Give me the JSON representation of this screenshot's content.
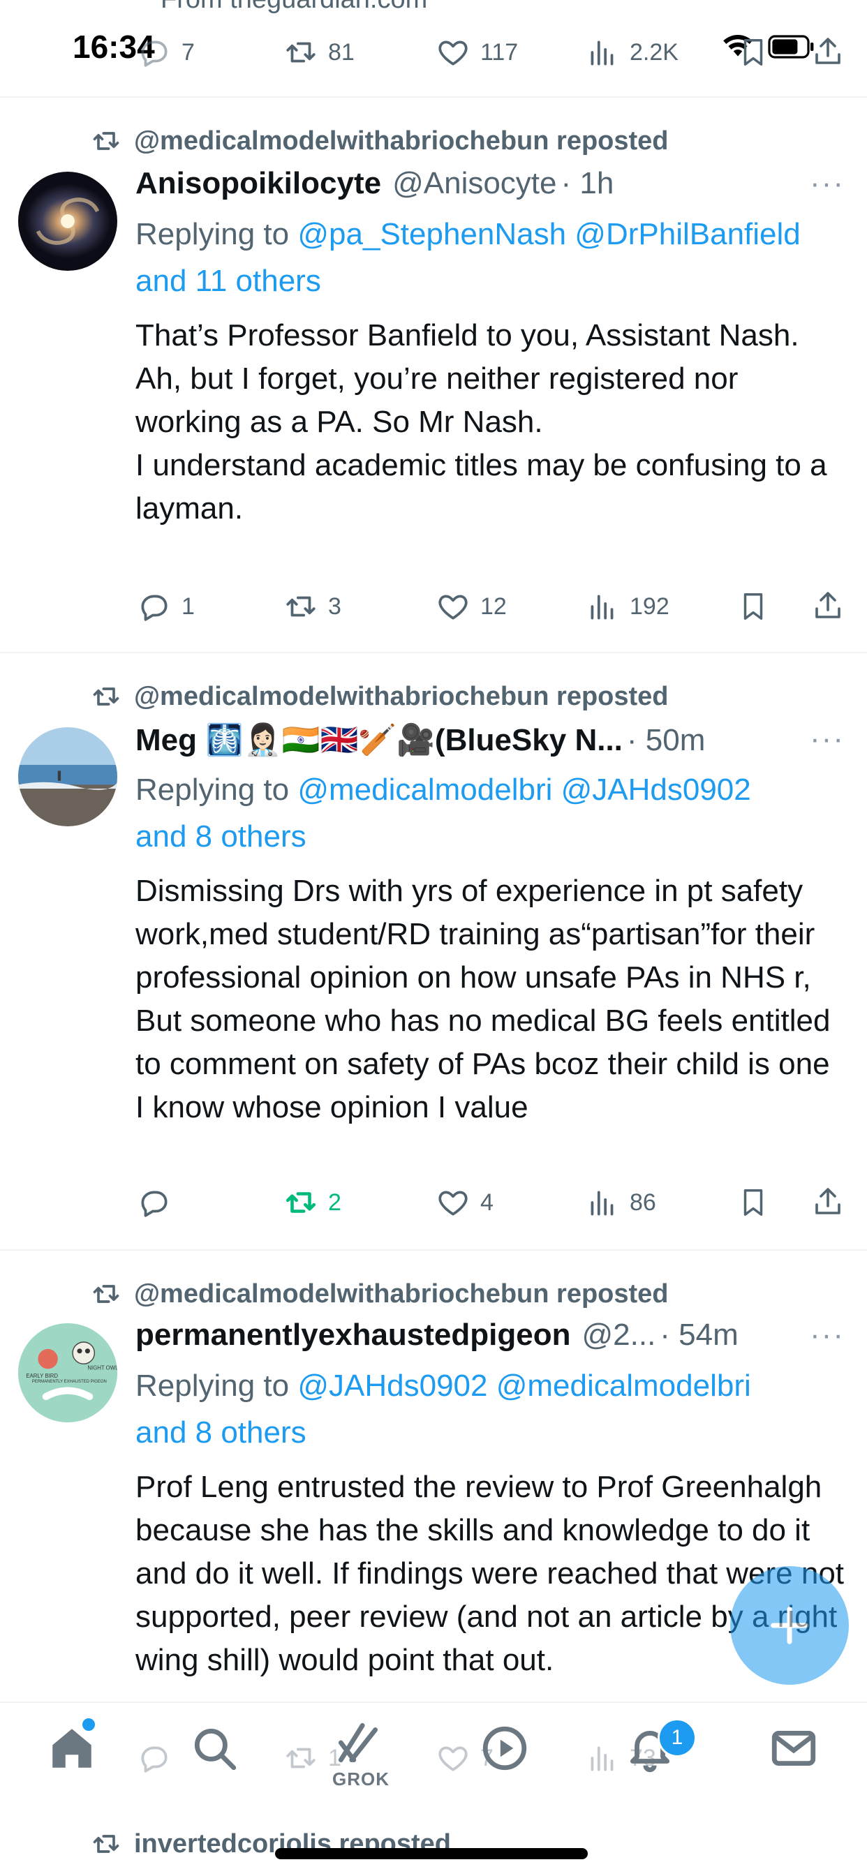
{
  "status_bar": {
    "time": "16:34",
    "prev_source": "From theguardian.com"
  },
  "prev_tweet_actions": {
    "replies": "7",
    "reposts": "81",
    "likes": "117",
    "views": "2.2K"
  },
  "tweets": [
    {
      "reposted_by": "@medicalmodelwithabriochebun reposted",
      "name": "Anisopoikilocyte",
      "handle": "@Anisocyte",
      "time": "· 1h",
      "replying_prefix": "Replying to ",
      "replying_handles": "@pa_StephenNash @DrPhilBanfield",
      "replying_others": "and 11 others",
      "text": "That’s Professor Banfield to you, Assistant Nash.\nAh, but I forget, you’re neither registered nor working as a PA. So Mr Nash.\nI understand academic titles may be confusing to a layman.",
      "replies": "1",
      "reposts": "3",
      "likes": "12",
      "views": "192"
    },
    {
      "reposted_by": "@medicalmodelwithabriochebun reposted",
      "name": "Meg 🩻👩🏻‍⚕️🇮🇳🇬🇧🏏🎥(BlueSky N...",
      "handle": "",
      "time": "· 50m",
      "replying_prefix": "Replying to ",
      "replying_handles": "@medicalmodelbri @JAHds0902",
      "replying_others": "and 8 others",
      "text": "Dismissing Drs with yrs of experience in pt safety work,med student/RD training as“partisan”for their professional opinion on how unsafe PAs in NHS r, But someone who has no medical BG feels entitled to comment on safety of PAs bcoz their child is one\nI know whose opinion I value",
      "replies": "",
      "reposts": "2",
      "likes": "4",
      "views": "86"
    },
    {
      "reposted_by": "@medicalmodelwithabriochebun reposted",
      "name": "permanentlyexhaustedpigeon",
      "handle": "@2...",
      "time": "· 54m",
      "replying_prefix": "Replying to ",
      "replying_handles": "@JAHds0902 @medicalmodelbri",
      "replying_others": "and 8 others",
      "text": "Prof Leng entrusted the review to Prof Greenhalgh because she has the skills and knowledge to do it and do it well. If findings were reached that were not supported, peer review (and not an article by a right wing shill) would point that out.",
      "replies": "",
      "reposts": "1",
      "likes": "7",
      "views": "73",
      "avatar_text": {
        "early": "EARLY BIRD",
        "night": "NIGHT OWL",
        "caption": "PERMANENTLY EXHAUSTED PIGEON"
      }
    }
  ],
  "tab_bar": {
    "grok_label": "GROK",
    "notifications_badge": "1"
  },
  "bottom_peek": {
    "reposted_by": "invertedcoriolis reposted"
  },
  "colors": {
    "accent": "#1d9bf0",
    "repost_active": "#00ba7c",
    "muted": "#536471"
  },
  "icons": [
    "reply-icon",
    "repost-icon",
    "like-icon",
    "views-icon",
    "bookmark-icon",
    "share-icon",
    "more-icon",
    "home-icon",
    "search-icon",
    "grok-icon",
    "play-icon",
    "bell-icon",
    "mail-icon",
    "plus-icon",
    "wifi-icon",
    "battery-icon"
  ]
}
